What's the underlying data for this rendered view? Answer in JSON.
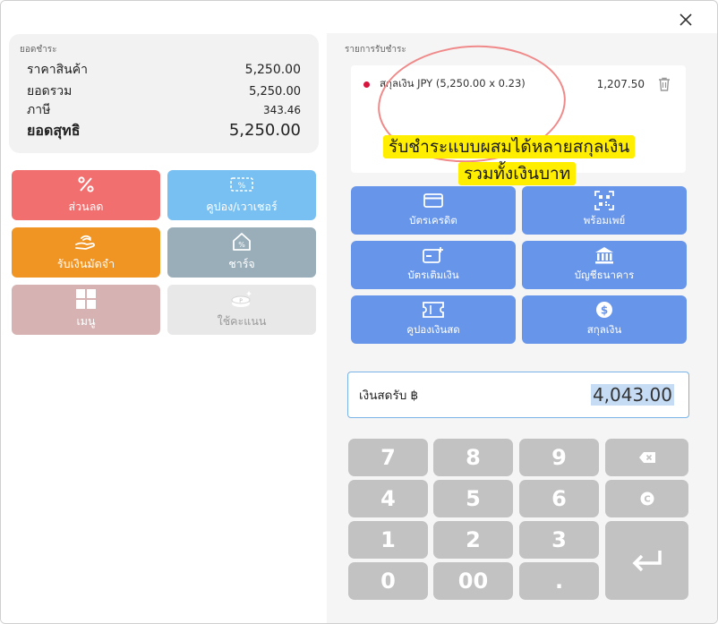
{
  "summary": {
    "caption": "ยอดชำระ",
    "rows": [
      {
        "label": "ราคาสินค้า",
        "value": "5,250.00"
      },
      {
        "label": "ยอดรวม",
        "value": "5,250.00"
      },
      {
        "label": "ภาษี",
        "value": "343.46"
      },
      {
        "label": "ยอดสุทธิ",
        "value": "5,250.00"
      }
    ]
  },
  "actions": {
    "discount": "ส่วนลด",
    "coupon": "คูปอง/เวาเชอร์",
    "deposit": "รับเงินมัดจำ",
    "charge": "ชาร์จ",
    "menu": "เมนู",
    "points": "ใช้คะแนน"
  },
  "payments": {
    "caption": "รายการรับชำระ",
    "items": [
      {
        "desc": "สกุลเงิน JPY (5,250.00 x 0.23)",
        "amount": "1,207.50",
        "dot_color": "#d9143c"
      }
    ]
  },
  "annotation": {
    "line1": "รับชำระแบบผสมได้หลายสกุลเงิน",
    "line2": "รวมทั้งเงินบาท"
  },
  "methods": {
    "credit": "บัตรเครดิต",
    "promptpay": "พร้อมเพย์",
    "topup": "บัตรเติมเงิน",
    "bank": "บัญชีธนาคาร",
    "cash_coupon": "คูปองเงินสด",
    "currency": "สกุลเงิน"
  },
  "cash": {
    "label": "เงินสดรับ ฿",
    "value": "4,043.00"
  },
  "keypad": {
    "k7": "7",
    "k8": "8",
    "k9": "9",
    "k4": "4",
    "k5": "5",
    "k6": "6",
    "k1": "1",
    "k2": "2",
    "k3": "3",
    "k0": "0",
    "k00": "00",
    "kdot": "."
  },
  "colors": {
    "discount": "#f26f6f",
    "coupon": "#79c0f2",
    "deposit": "#f09424",
    "charge": "#9aaeba",
    "menu": "#d6b3b2",
    "method": "#6795ea",
    "keypad": "#c2c2c2",
    "highlight": "#ffee00"
  }
}
